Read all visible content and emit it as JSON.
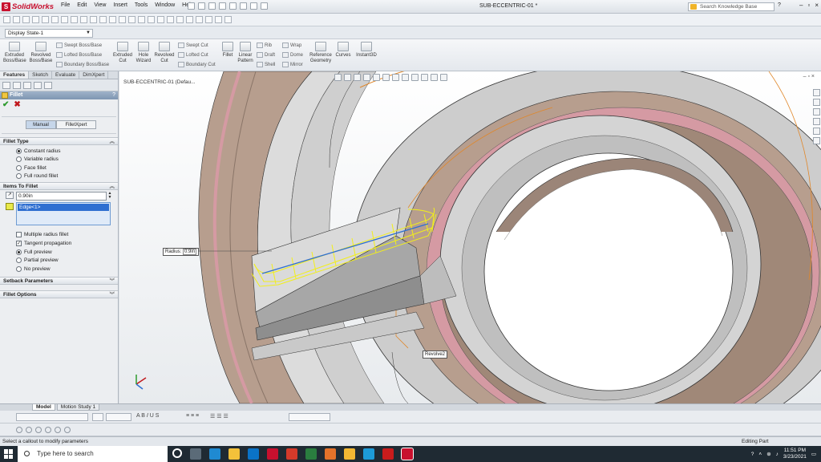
{
  "app": {
    "logo_text": "SolidWorks",
    "menu": [
      "File",
      "Edit",
      "View",
      "Insert",
      "Tools",
      "Window",
      "Help"
    ],
    "doc_title": "SUB-ECCENTRIC-01 *",
    "kb_search_placeholder": "Search Knowledge Base",
    "help_label": "?"
  },
  "display_state": "Display State-1",
  "ribbon": {
    "buttons": [
      {
        "label": "Extruded Boss/Base"
      },
      {
        "label": "Revolved Boss/Base"
      },
      {
        "label": "Extruded Cut"
      },
      {
        "label": "Hole Wizard"
      },
      {
        "label": "Revolved Cut"
      },
      {
        "label": "Fillet"
      },
      {
        "label": "Linear Pattern"
      },
      {
        "label": "Reference Geometry"
      },
      {
        "label": "Curves"
      },
      {
        "label": "Instant3D"
      }
    ],
    "small": [
      "Swept Boss/Base",
      "Lofted Boss/Base",
      "Boundary Boss/Base",
      "Swept Cut",
      "Lofted Cut",
      "Boundary Cut",
      "Rib",
      "Draft",
      "Shell",
      "Wrap",
      "Dome",
      "Mirror"
    ]
  },
  "panel": {
    "tabs": [
      "Features",
      "Sketch",
      "Evaluate",
      "DimXpert"
    ],
    "title": "Fillet",
    "help": "?",
    "mode": {
      "manual": "Manual",
      "expert": "FilletXpert"
    },
    "fillet_type": {
      "header": "Fillet Type",
      "options": [
        "Constant radius",
        "Variable radius",
        "Face fillet",
        "Full round fillet"
      ],
      "selected": 0
    },
    "items": {
      "header": "Items To Fillet",
      "radius": "0.90in",
      "edges": [
        "Edge<1>"
      ],
      "multiple_radius": "Multiple radius fillet",
      "tangent": "Tangent propagation",
      "preview_options": [
        "Full preview",
        "Partial preview",
        "No preview"
      ],
      "preview_selected": 0
    },
    "setback_header": "Setback Parameters",
    "options_header": "Fillet Options"
  },
  "viewport": {
    "tree_label": "SUB-ECCENTRIC-01  (Defau...",
    "radius_callout_label": "Radius:",
    "radius_callout_value": "0.9in",
    "feature_callout": "Revolve2"
  },
  "bottom_tabs": [
    "Model",
    "Motion Study 1"
  ],
  "status": {
    "message": "Select a callout to modify parameters",
    "mode": "Editing Part"
  },
  "taskbar": {
    "search_placeholder": "Type here to search",
    "time": "11:51 PM",
    "date": "3/23/2021"
  },
  "colors": {
    "accent": "#2f6fd1",
    "fillet_preview": "#f2ef1a",
    "selection_edge": "#e0872a",
    "body_tan": "#b79e8e",
    "body_pink": "#d59aa3"
  }
}
